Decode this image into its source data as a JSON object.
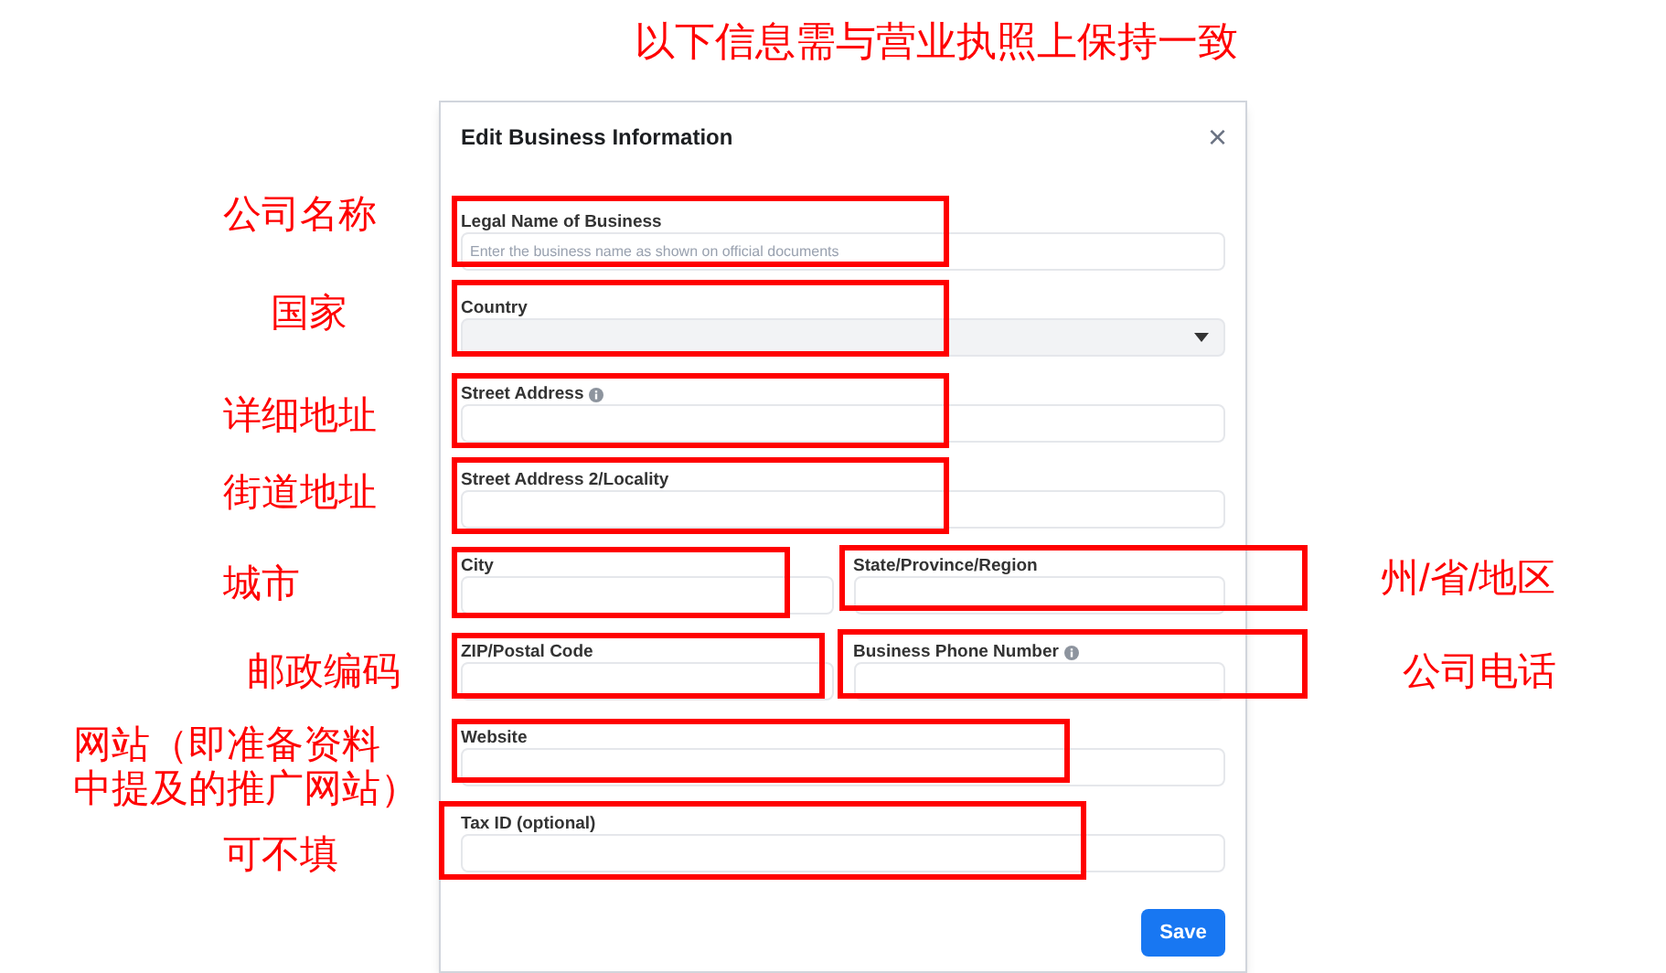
{
  "header_note": "以下信息需与营业执照上保持一致",
  "dialog": {
    "title": "Edit Business Information",
    "close": "×",
    "rows": [
      [
        {
          "label": "Legal Name of Business",
          "kind": "text",
          "info": false,
          "placeholder": "Enter the business name as shown on official documents"
        }
      ],
      [
        {
          "label": "Country",
          "kind": "select",
          "info": false
        }
      ],
      [
        {
          "label": "Street Address",
          "kind": "text",
          "info": true
        }
      ],
      [
        {
          "label": "Street Address 2/Locality",
          "kind": "text",
          "info": false
        }
      ],
      [
        {
          "label": "City",
          "kind": "text",
          "info": false
        },
        {
          "label": "State/Province/Region",
          "kind": "text",
          "info": false
        }
      ],
      [
        {
          "label": "ZIP/Postal Code",
          "kind": "text",
          "info": false
        },
        {
          "label": "Business Phone Number",
          "kind": "text",
          "info": true
        }
      ],
      [
        {
          "label": "Website",
          "kind": "text",
          "info": false
        }
      ],
      [
        {
          "label": "Tax ID (optional)",
          "kind": "text",
          "info": false
        }
      ]
    ],
    "save": "Save"
  },
  "annotations": [
    {
      "lines": [
        "公司名称"
      ]
    },
    {
      "lines": [
        "国家"
      ]
    },
    {
      "lines": [
        "详细地址"
      ]
    },
    {
      "lines": [
        "街道地址"
      ]
    },
    {
      "lines": [
        "城市"
      ]
    },
    {
      "lines": [
        "州/省/地区"
      ]
    },
    {
      "lines": [
        "邮政编码"
      ]
    },
    {
      "lines": [
        "公司电话"
      ]
    },
    {
      "lines": [
        "网站（即准备资料",
        "中提及的推广网站）"
      ]
    },
    {
      "lines": [
        "可不填"
      ]
    }
  ]
}
